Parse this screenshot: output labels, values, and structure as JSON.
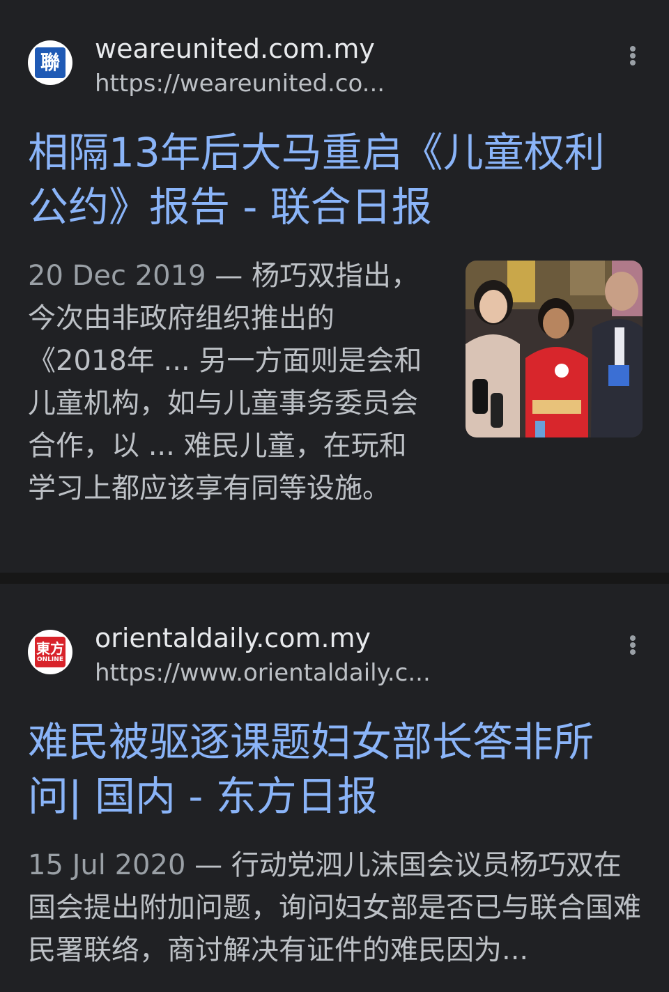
{
  "results": [
    {
      "favicon_icon": "lianhe-zaobao-logo-icon",
      "favicon_text": "聯",
      "site_name": "weareunited.com.my",
      "site_url": "https://weareunited.co...",
      "title": "相隔13年后大马重启《儿童权利公约》报告 - 联合日报",
      "date": "20 Dec 2019",
      "snippet": " — 杨巧双指出，今次由非政府组织推出的《2018年 ... 另一方面则是会和儿童机构，如与儿童事务委员会合作，以 ... 难民儿童，在玩和学习上都应该享有同等设施。",
      "has_thumbnail": true
    },
    {
      "favicon_icon": "oriental-daily-logo-icon",
      "favicon_text": "東方",
      "favicon_subtext": "ONLINE",
      "site_name": "orientaldaily.com.my",
      "site_url": "https://www.orientaldaily.c...",
      "title": "难民被驱逐课题妇女部长答非所问| 国内 - 东方日报",
      "date": "15 Jul 2020",
      "snippet": " — 行动党泗儿沫国会议员杨巧双在国会提出附加问题，询问妇女部是否已与联合国难民署联络，商讨解决有证件的难民因为...",
      "has_thumbnail": false
    }
  ],
  "colors": {
    "background": "#202124",
    "title_link": "#8ab4f8",
    "site_name": "#e8eaed",
    "snippet": "#bdc1c6"
  }
}
